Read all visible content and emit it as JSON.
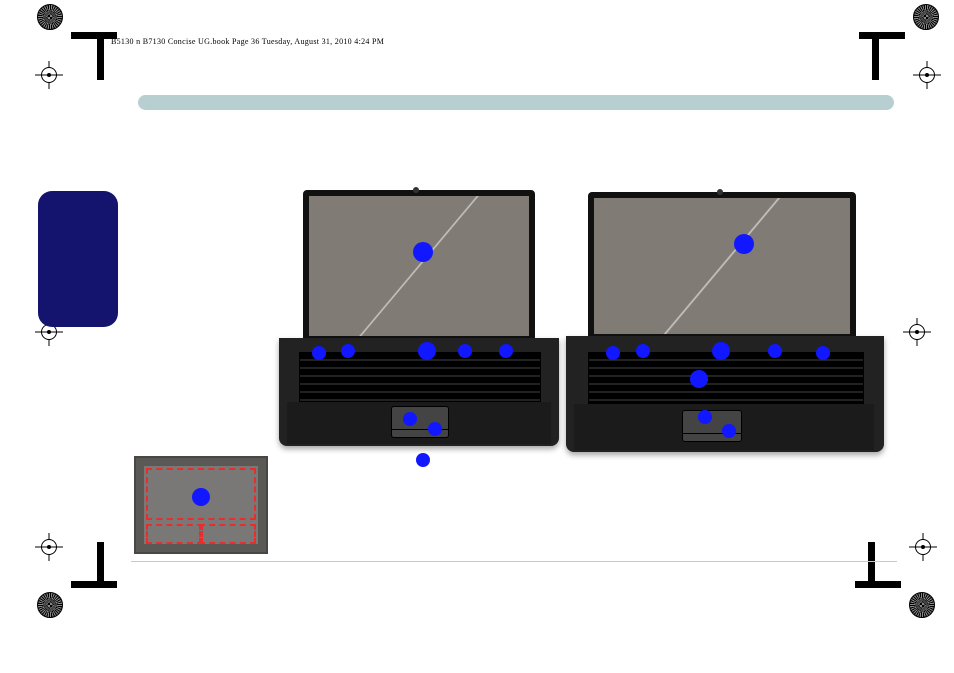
{
  "header_text": "B5130 n B7130 Concise UG.book  Page 36  Tuesday, August 31, 2010  4:24 PM",
  "page_number": "36",
  "callout_count_per_laptop": 9,
  "colors": {
    "accent": "#1117ff",
    "side_tab": "#14136e",
    "bar": "#b7cfd1",
    "dash": "#e62e2e"
  }
}
